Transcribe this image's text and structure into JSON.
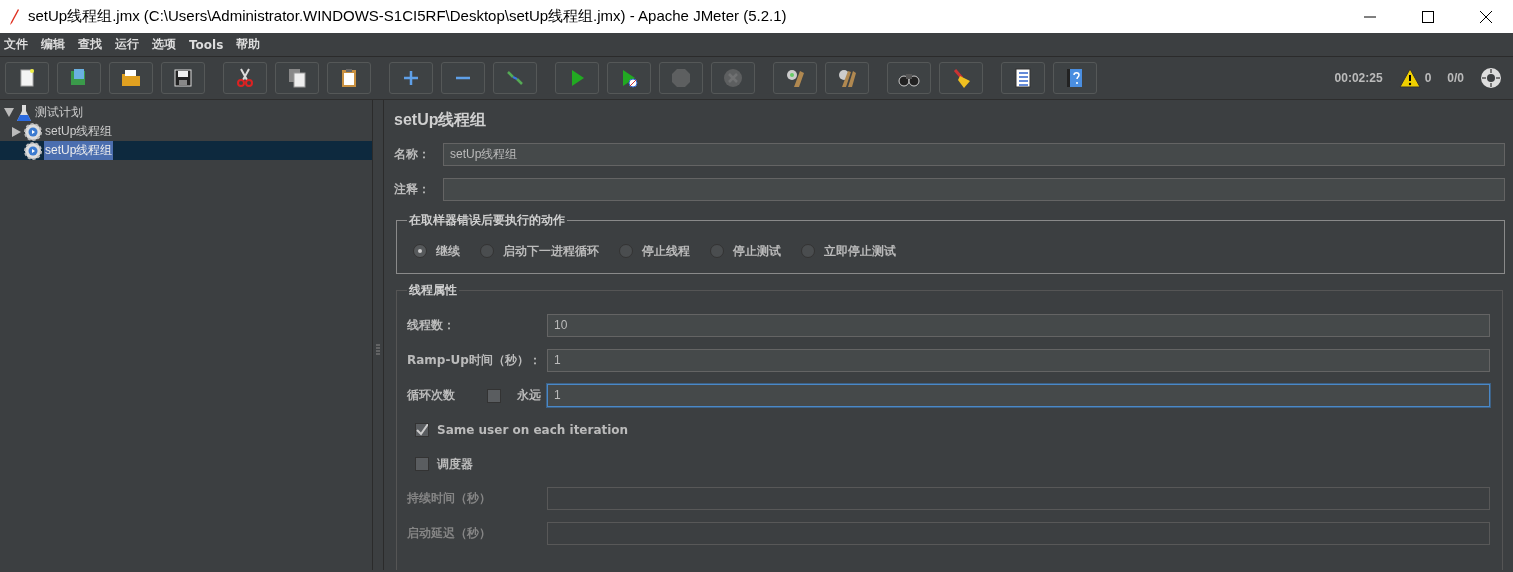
{
  "window": {
    "title": "setUp线程组.jmx (C:\\Users\\Administrator.WINDOWS-S1CI5RF\\Desktop\\setUp线程组.jmx) - Apache JMeter (5.2.1)"
  },
  "menu": [
    {
      "label": "文件"
    },
    {
      "label": "编辑"
    },
    {
      "label": "查找"
    },
    {
      "label": "运行"
    },
    {
      "label": "选项"
    },
    {
      "label": "Tools"
    },
    {
      "label": "帮助"
    }
  ],
  "toolbar": {
    "groups": [
      [
        {
          "disabled": false
        },
        {
          "disabled": false
        },
        {
          "disabled": false
        },
        {
          "disabled": false
        }
      ],
      [
        {
          "disabled": false
        },
        {
          "disabled": false
        },
        {
          "disabled": false
        }
      ],
      [
        {
          "disabled": false
        },
        {
          "disabled": false
        },
        {
          "disabled": false
        }
      ],
      [
        {
          "disabled": false
        },
        {
          "disabled": false
        },
        {
          "disabled": true
        },
        {
          "disabled": true
        }
      ],
      [
        {
          "disabled": false
        },
        {
          "disabled": false
        }
      ],
      [
        {
          "disabled": false
        },
        {
          "disabled": false
        }
      ],
      [
        {
          "disabled": false
        },
        {
          "disabled": false
        }
      ]
    ],
    "elapsed": "00:02:25",
    "warnings": "0",
    "threads": "0/0"
  },
  "tree": [
    {
      "label": "测试计划",
      "kind": "plan",
      "expanded": true,
      "selected": false,
      "children": [
        {
          "label": "setUp线程组",
          "kind": "thread-group",
          "expanded": false,
          "selected": false
        },
        {
          "label": "setUp线程组",
          "kind": "thread-group",
          "selected": true
        }
      ]
    }
  ],
  "panel": {
    "title": "setUp线程组",
    "fields": [
      {
        "label": "名称：",
        "value": "setUp线程组"
      },
      {
        "label": "注释："
      }
    ],
    "error_action": {
      "title": "在取样器错误后要执行的动作",
      "options": [
        {
          "label": "继续",
          "selected": true
        },
        {
          "label": "启动下一进程循环",
          "selected": false
        },
        {
          "label": "停止线程",
          "selected": false
        },
        {
          "label": "停止测试",
          "selected": false
        },
        {
          "label": "立即停止测试",
          "selected": false
        }
      ]
    },
    "thread_properties": {
      "title": "线程属性",
      "rows": [
        {
          "kind": "field",
          "label": "线程数：",
          "value": "10",
          "focused": false,
          "disabled": false
        },
        {
          "kind": "field",
          "label": "Ramp-Up时间（秒）：",
          "value": "1",
          "focused": false,
          "disabled": false
        },
        {
          "kind": "loop",
          "label": "循环次数",
          "checkbox": {
            "label": "永远",
            "checked": false
          },
          "value": "1",
          "focused": true,
          "disabled": false
        },
        {
          "kind": "checkbox",
          "label": "Same user on each iteration",
          "checked": true
        },
        {
          "kind": "checkbox",
          "label": "调度器",
          "checked": false
        },
        {
          "kind": "field",
          "label": "持续时间（秒）",
          "focused": false,
          "disabled": true
        },
        {
          "kind": "field",
          "label": "启动延迟（秒）",
          "focused": false,
          "disabled": true
        }
      ]
    }
  }
}
